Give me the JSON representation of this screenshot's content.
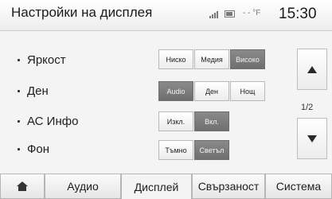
{
  "header": {
    "title": "Настройки на дисплея",
    "temperature": "- - °F",
    "time": "15:30",
    "status_icons": [
      "signal-icon",
      "battery-icon"
    ]
  },
  "settings": {
    "rows": [
      {
        "label": "Яркост",
        "options": [
          "Ниско",
          "Медия",
          "Високо"
        ],
        "selected": "Високо"
      },
      {
        "label": "Ден",
        "options": [
          "Audio",
          "Ден",
          "Нощ"
        ],
        "selected": "Audio"
      },
      {
        "label": "АС Инфо",
        "options": [
          "Изкл.",
          "Вкл."
        ],
        "selected": "Вкл."
      },
      {
        "label": "Фон",
        "options": [
          "Тъмно",
          "Светъл"
        ],
        "selected": "Светъл"
      }
    ]
  },
  "pager": {
    "text": "1/2"
  },
  "tabs": [
    {
      "label": "home-icon"
    },
    {
      "label": "Аудио"
    },
    {
      "label": "Дисплей",
      "active": true
    },
    {
      "label": "Свързаност"
    },
    {
      "label": "Система"
    }
  ],
  "colors": {
    "selected_button": "#7c7c7c",
    "background": "#f4f4f4"
  }
}
